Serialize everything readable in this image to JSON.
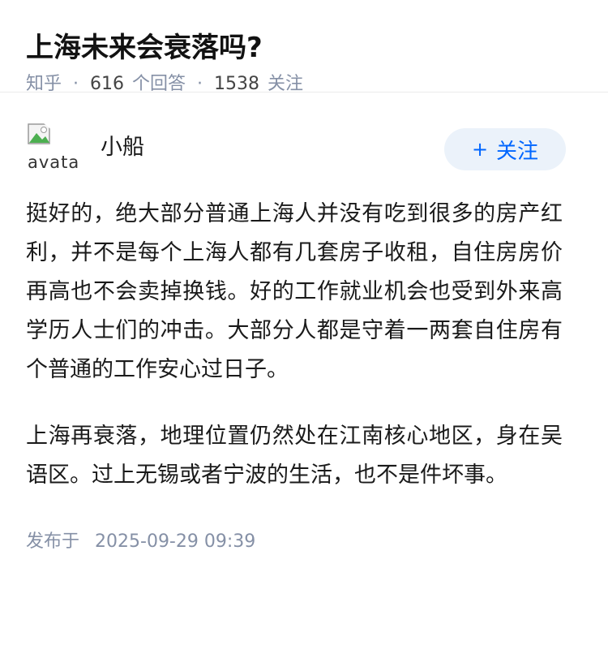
{
  "question": {
    "title": "上海未来会衰落吗?",
    "source": "知乎",
    "answers_count": "616",
    "answers_label": "个回答",
    "followers_count": "1538",
    "followers_label": "关注",
    "separator": "·"
  },
  "answer": {
    "avatar_alt": "avatar",
    "author_name": "小船",
    "follow_icon": "+",
    "follow_label": "关注",
    "paragraphs": [
      "挺好的，绝大部分普通上海人并没有吃到很多的房产红利，并不是每个上海人都有几套房子收租，自住房房价再高也不会卖掉换钱。好的工作就业机会也受到外来高学历人士们的冲击。大部分人都是守着一两套自住房有个普通的工作安心过日子。",
      "上海再衰落，地理位置仍然处在江南核心地区，身在吴语区。过上无锡或者宁波的生活，也不是件坏事。"
    ],
    "publish_label": "发布于",
    "publish_time": "2025-09-29 09:39"
  },
  "colors": {
    "accent": "#0066ff",
    "follow_bg": "#ebf2fa",
    "meta_gray": "#8590a6",
    "text": "#1a1a1a"
  },
  "icons": {
    "avatar": "broken-image-icon",
    "follow": "plus-icon"
  }
}
